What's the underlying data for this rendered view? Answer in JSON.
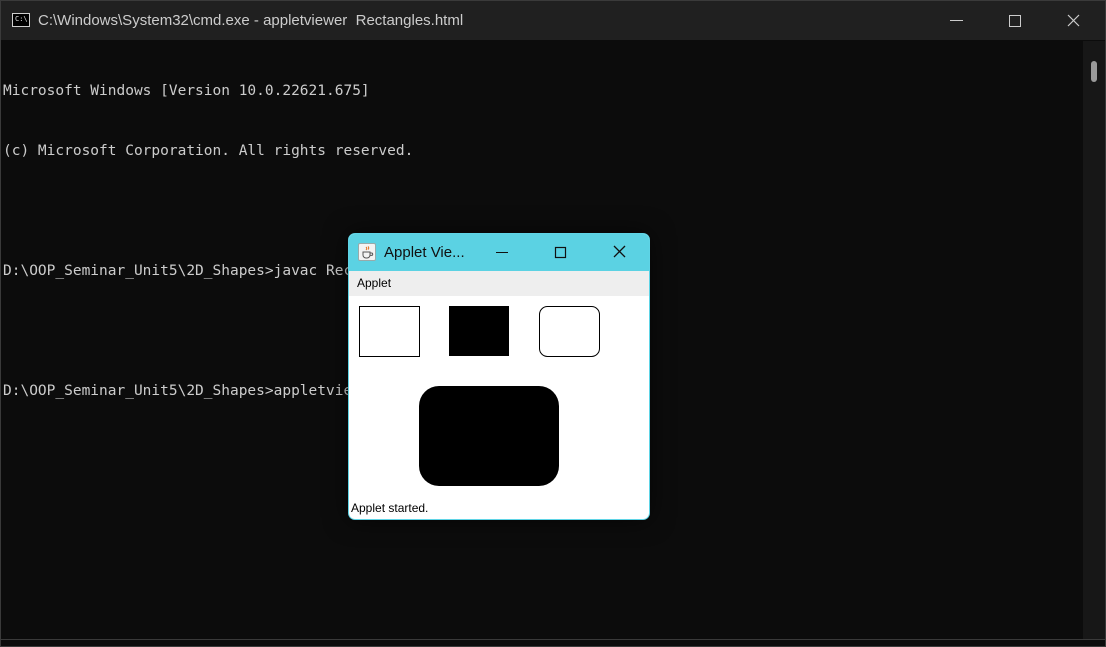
{
  "cmd": {
    "title": "C:\\Windows\\System32\\cmd.exe - appletviewer  Rectangles.html",
    "icon_text": "C:\\",
    "lines": [
      "Microsoft Windows [Version 10.0.22621.675]",
      "(c) Microsoft Corporation. All rights reserved.",
      "",
      "D:\\OOP_Seminar_Unit5\\2D_Shapes>javac Rectangles.java",
      "",
      "D:\\OOP_Seminar_Unit5\\2D_Shapes>appletviewer Rectangles.html"
    ],
    "colors": {
      "background": "#0c0c0c",
      "titlebar": "#202020",
      "text": "#cccccc"
    }
  },
  "applet_viewer": {
    "title": "Applet Vie...",
    "menu": "Applet",
    "status": "Applet started.",
    "colors": {
      "titlebar": "#5bd2e3",
      "canvas": "#ffffff",
      "shapes": "#000000"
    },
    "shapes": [
      {
        "name": "outlined-rectangle",
        "kind": "drawRect",
        "filled": false,
        "rounded": false
      },
      {
        "name": "filled-rectangle",
        "kind": "fillRect",
        "filled": true,
        "rounded": false
      },
      {
        "name": "outlined-rounded-rectangle",
        "kind": "drawRoundRect",
        "filled": false,
        "rounded": true
      },
      {
        "name": "filled-rounded-rectangle",
        "kind": "fillRoundRect",
        "filled": true,
        "rounded": true
      }
    ]
  },
  "icons": {
    "cmd": "cmd-icon",
    "java": "java-cup-icon",
    "minimize": "minimize-icon",
    "maximize": "maximize-icon",
    "close": "close-icon"
  }
}
